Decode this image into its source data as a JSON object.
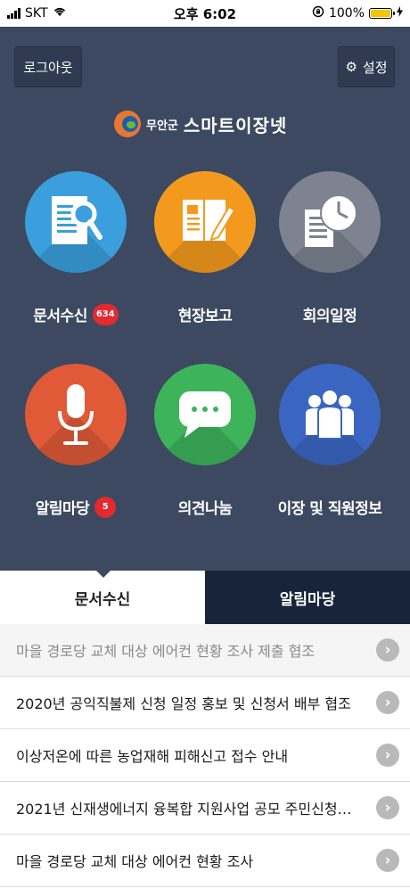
{
  "status_bar": {
    "carrier": "SKT",
    "time": "오후 6:02",
    "battery": "100%"
  },
  "header": {
    "logout_label": "로그아웃",
    "settings_label": "설정",
    "logo_org": "무안군",
    "logo_name": "스마트이장넷"
  },
  "menu": [
    {
      "label": "문서수신",
      "badge": "634",
      "icon": "document-search-icon",
      "color": "#3a9fdc"
    },
    {
      "label": "현장보고",
      "badge": "",
      "icon": "notebook-pen-icon",
      "color": "#f39a1e"
    },
    {
      "label": "회의일정",
      "badge": "",
      "icon": "clock-document-icon",
      "color": "#7d8390"
    },
    {
      "label": "알림마당",
      "badge": "5",
      "icon": "microphone-icon",
      "color": "#e05a37"
    },
    {
      "label": "의견나눔",
      "badge": "",
      "icon": "chat-bubble-icon",
      "color": "#3db35a"
    },
    {
      "label": "이장 및 직원정보",
      "badge": "",
      "icon": "people-icon",
      "color": "#3a66c2"
    }
  ],
  "tabs": [
    {
      "label": "문서수신",
      "active": true
    },
    {
      "label": "알림마당",
      "active": false
    }
  ],
  "list": [
    {
      "title": "마을 경로당 교체 대상 에어컨 현황 조사 제출 협조"
    },
    {
      "title": "2020년 공익직불제 신청 일정 홍보 및 신청서 배부 협조"
    },
    {
      "title": "이상저온에 따른 농업재해 피해신고 접수 안내"
    },
    {
      "title": "2021년 신재생에너지 융복합 지원사업 공모 주민신청…"
    },
    {
      "title": "마을 경로당 교체 대상 에어컨 현황 조사"
    }
  ]
}
